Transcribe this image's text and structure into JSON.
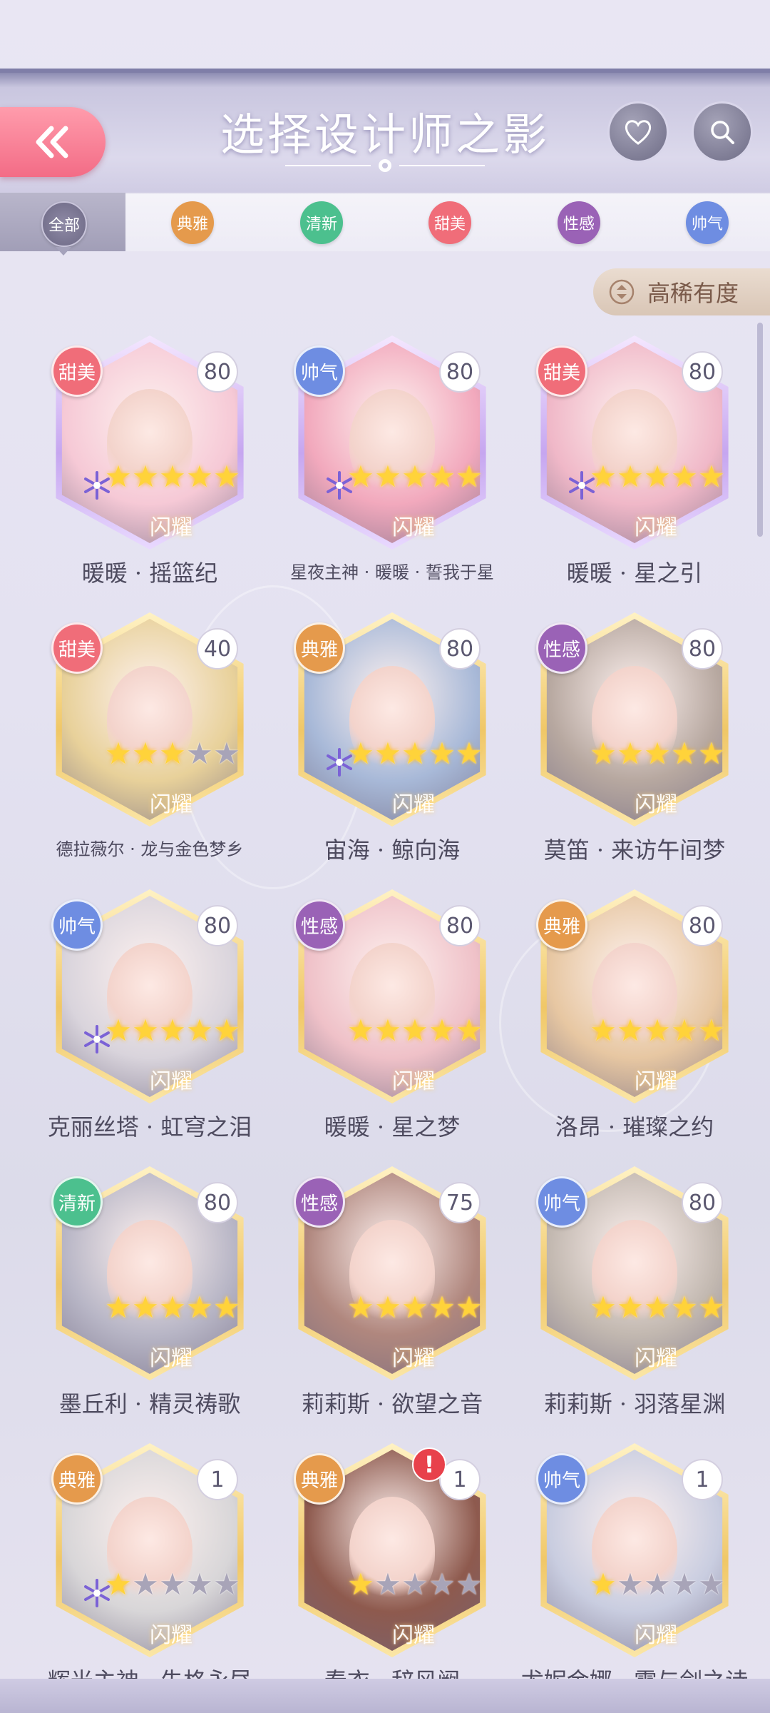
{
  "header": {
    "title": "选择设计师之影"
  },
  "tabs": [
    {
      "label": "全部",
      "color": "#7a7592"
    },
    {
      "label": "典雅",
      "color": "#e59a4c"
    },
    {
      "label": "清新",
      "color": "#4cc08e"
    },
    {
      "label": "甜美",
      "color": "#f06d79"
    },
    {
      "label": "性感",
      "color": "#9a62b6"
    },
    {
      "label": "帅气",
      "color": "#6e8de2"
    }
  ],
  "sort": {
    "label": "高稀有度"
  },
  "tag_colors": {
    "甜美": "#f06d79",
    "帅气": "#6e8de2",
    "典雅": "#e59a4c",
    "性感": "#9a62b6",
    "清新": "#4cc08e"
  },
  "cards": [
    {
      "tag": "甜美",
      "level": "80",
      "stars": 5,
      "frame": "purple",
      "snow": true,
      "name": "暖暖 · 摇篮纪",
      "portrait": "#f6c9d6"
    },
    {
      "tag": "帅气",
      "level": "80",
      "stars": 5,
      "frame": "purple",
      "snow": true,
      "name": "星夜主神 · 暖暖 · 誓我于星",
      "small": true,
      "portrait": "#f2a9bd"
    },
    {
      "tag": "甜美",
      "level": "80",
      "stars": 5,
      "frame": "purple",
      "snow": true,
      "name": "暖暖 · 星之引",
      "portrait": "#f0b8c8"
    },
    {
      "tag": "甜美",
      "level": "40",
      "stars": 3,
      "frame": "gold",
      "snow": false,
      "name": "德拉薇尔 · 龙与金色梦乡",
      "small": true,
      "portrait": "#e8d19a"
    },
    {
      "tag": "典雅",
      "level": "80",
      "stars": 5,
      "frame": "gold",
      "snow": true,
      "name": "宙海 · 鲸向海",
      "portrait": "#a8b9d8"
    },
    {
      "tag": "性感",
      "level": "80",
      "stars": 5,
      "frame": "gold",
      "snow": false,
      "name": "莫笛 · 来访午间梦",
      "portrait": "#b7a8a0"
    },
    {
      "tag": "帅气",
      "level": "80",
      "stars": 5,
      "frame": "gold",
      "snow": true,
      "name": "克丽丝塔 · 虹穹之泪",
      "portrait": "#d9d4dc"
    },
    {
      "tag": "性感",
      "level": "80",
      "stars": 5,
      "frame": "gold",
      "snow": false,
      "name": "暖暖 · 星之梦",
      "portrait": "#efc1c8"
    },
    {
      "tag": "典雅",
      "level": "80",
      "stars": 5,
      "frame": "gold",
      "snow": false,
      "name": "洛昂 · 璀璨之约",
      "portrait": "#e7c7a2"
    },
    {
      "tag": "清新",
      "level": "80",
      "stars": 5,
      "frame": "gold",
      "snow": false,
      "name": "墨丘利 · 精灵祷歌",
      "portrait": "#b8b6c6"
    },
    {
      "tag": "性感",
      "level": "75",
      "stars": 5,
      "frame": "gold",
      "snow": false,
      "name": "莉莉斯 · 欲望之音",
      "portrait": "#b0877e"
    },
    {
      "tag": "帅气",
      "level": "80",
      "stars": 5,
      "frame": "gold",
      "snow": false,
      "name": "莉莉斯 · 羽落星渊",
      "portrait": "#c2b8b0"
    },
    {
      "tag": "典雅",
      "level": "1",
      "stars": 1,
      "frame": "gold",
      "snow": true,
      "name": "辉光主神 · 失格永昼",
      "portrait": "#d8d6d8"
    },
    {
      "tag": "典雅",
      "level": "1",
      "stars": 1,
      "frame": "gold",
      "snow": false,
      "alert": "!",
      "name": "春衣 · 辞风阙",
      "portrait": "#8e5a4e"
    },
    {
      "tag": "帅气",
      "level": "1",
      "stars": 1,
      "frame": "gold",
      "snow": false,
      "name": "尤妮金娜 · 霜与剑之诗",
      "portrait": "#c9cde0"
    }
  ],
  "flash_label": "闪耀"
}
